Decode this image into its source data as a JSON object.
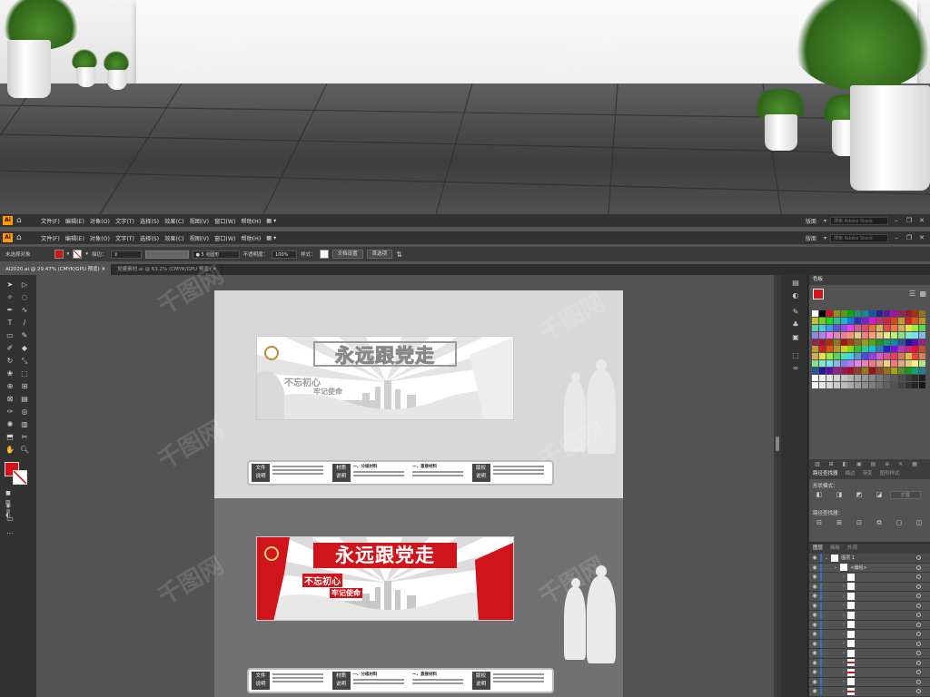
{
  "app": {
    "menus": [
      "文件(F)",
      "编辑(E)",
      "对象(O)",
      "文字(T)",
      "选择(S)",
      "效果(C)",
      "视图(V)",
      "窗口(W)",
      "帮助(H)"
    ],
    "workspace": "版面",
    "search_placeholder": "搜索 Adobe Stock"
  },
  "control": {
    "no_selection": "未选择对象",
    "stroke_label": "描边：",
    "brush": "5 点圆形",
    "opacity_label": "不透明度：",
    "opacity": "100%",
    "style_label": "样式：",
    "doc_setup": "文档设置",
    "prefs": "首选项"
  },
  "tabs": [
    {
      "label": "AI2020.ai @ 29.47% (CMYK/GPU 预览)"
    },
    {
      "label": "党建素材.ai @ 63.2% (CMYK/GPU 预览)"
    }
  ],
  "design": {
    "title": "永远跟党走",
    "tag1": "不忘初心",
    "tag2": "牢记使命",
    "info_labels": [
      "文件\n说明",
      "材质\n说明",
      "版权\n说明"
    ],
    "info_heads": [
      "一、分级材料",
      "一、直接材料"
    ]
  },
  "panels": {
    "swatches_title": "色板",
    "pathfinder_tabs": [
      "路径查找器",
      "描边",
      "渐变",
      "图形样式"
    ],
    "shape_modes": "形状模式：",
    "pathfinders": "路径查找器：",
    "expand": "扩展",
    "layers_tabs": [
      "图层",
      "画板",
      "外观"
    ],
    "layer1": "图层 1",
    "group": "<编组>"
  },
  "colors": {
    "accent_red": "#d0141b",
    "ui_dark": "#323232",
    "panel_mid": "#535353"
  },
  "watermark": "千图网"
}
